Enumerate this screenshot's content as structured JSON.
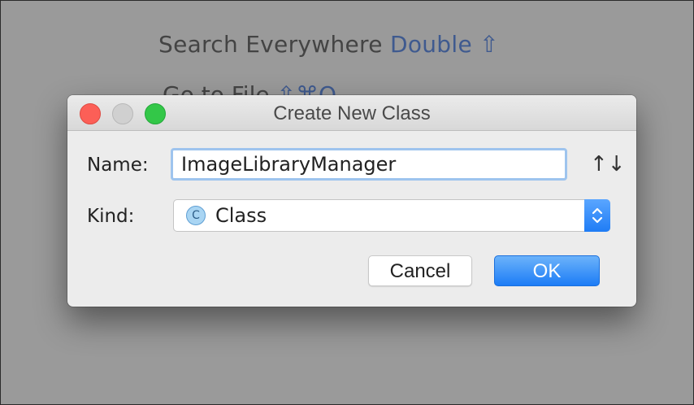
{
  "background_hints": {
    "search_everywhere": {
      "label": "Search Everywhere",
      "shortcut": "Double ⇧"
    },
    "go_to_file": {
      "label": "Go to File",
      "shortcut": "⇧⌘O"
    }
  },
  "dialog": {
    "title": "Create New Class",
    "name_label": "Name:",
    "name_value": "ImageLibraryManager",
    "kind_label": "Kind:",
    "kind_value": "Class",
    "kind_icon_letter": "C",
    "sort_icon": "↑↓",
    "cancel_label": "Cancel",
    "ok_label": "OK"
  },
  "colors": {
    "accent": "#1f7cf5",
    "shortcut": "#3f5a8f",
    "close": "#fc5f57",
    "maximize": "#33c748"
  },
  "icons": {
    "close": "close-icon",
    "minimize": "minimize-icon",
    "maximize": "maximize-icon",
    "sort": "sort-icon",
    "class": "class-icon",
    "stepper": "chevron-up-down-icon"
  }
}
